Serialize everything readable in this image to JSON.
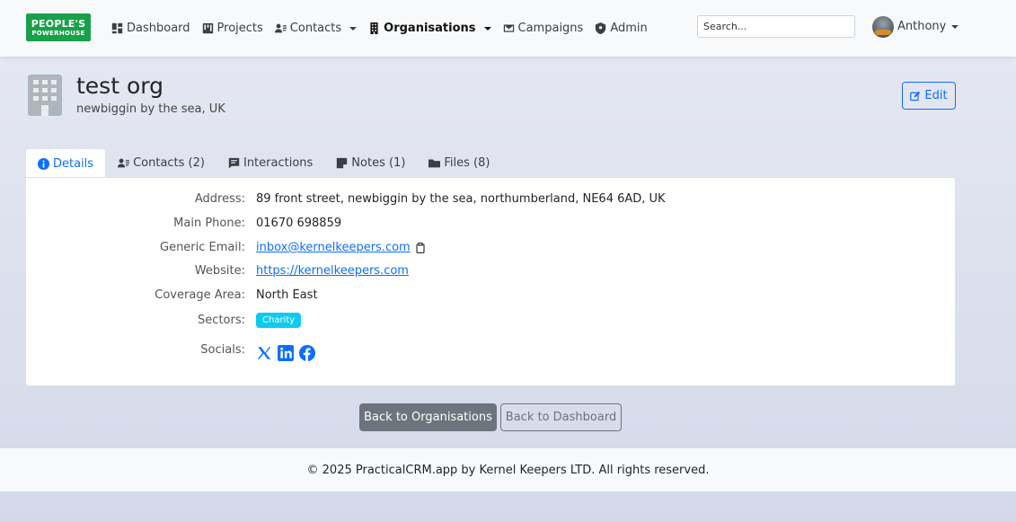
{
  "brand": {
    "line1": "PEOPLE'S",
    "line2": "POWERHOUSE",
    "color": "#19a04a"
  },
  "nav": {
    "items": [
      {
        "label": "Dashboard",
        "icon": "dashboard-icon"
      },
      {
        "label": "Projects",
        "icon": "kanban-icon"
      },
      {
        "label": "Contacts",
        "icon": "contacts-icon",
        "dropdown": true
      },
      {
        "label": "Organisations",
        "icon": "building-icon",
        "dropdown": true,
        "active": true
      },
      {
        "label": "Campaigns",
        "icon": "envelope-icon"
      },
      {
        "label": "Admin",
        "icon": "shield-icon"
      }
    ],
    "search_placeholder": "Search...",
    "user_name": "Anthony"
  },
  "org": {
    "name": "test org",
    "location": "newbiggin by the sea, UK",
    "edit_label": "Edit"
  },
  "tabs": [
    {
      "label": "Details",
      "icon": "info-icon",
      "active": true
    },
    {
      "label": "Contacts (2)",
      "icon": "contacts-icon"
    },
    {
      "label": "Interactions",
      "icon": "chat-icon"
    },
    {
      "label": "Notes (1)",
      "icon": "sticky-note-icon"
    },
    {
      "label": "Files (8)",
      "icon": "folder-icon"
    }
  ],
  "details": {
    "address": {
      "label": "Address:",
      "value": "89 front street, newbiggin by the sea, northumberland, NE64 6AD, UK"
    },
    "phone": {
      "label": "Main Phone:",
      "value": "01670 698859"
    },
    "email": {
      "label": "Generic Email:",
      "value": "inbox@kernelkeepers.com"
    },
    "website": {
      "label": "Website:",
      "value": "https://kernelkeepers.com"
    },
    "coverage": {
      "label": "Coverage Area:",
      "value": "North East"
    },
    "sectors": {
      "label": "Sectors:",
      "values": [
        "Charity"
      ]
    },
    "socials": {
      "label": "Socials:",
      "items": [
        "x-icon",
        "linkedin-icon",
        "facebook-icon"
      ]
    }
  },
  "actions": {
    "back_orgs": "Back to Organisations",
    "back_dashboard": "Back to Dashboard"
  },
  "footer": {
    "text": "© 2025 PracticalCRM.app by Kernel Keepers LTD. All rights reserved."
  },
  "colors": {
    "primary": "#0d6efd",
    "secondary": "#6c757d",
    "info": "#0dcaf0"
  }
}
